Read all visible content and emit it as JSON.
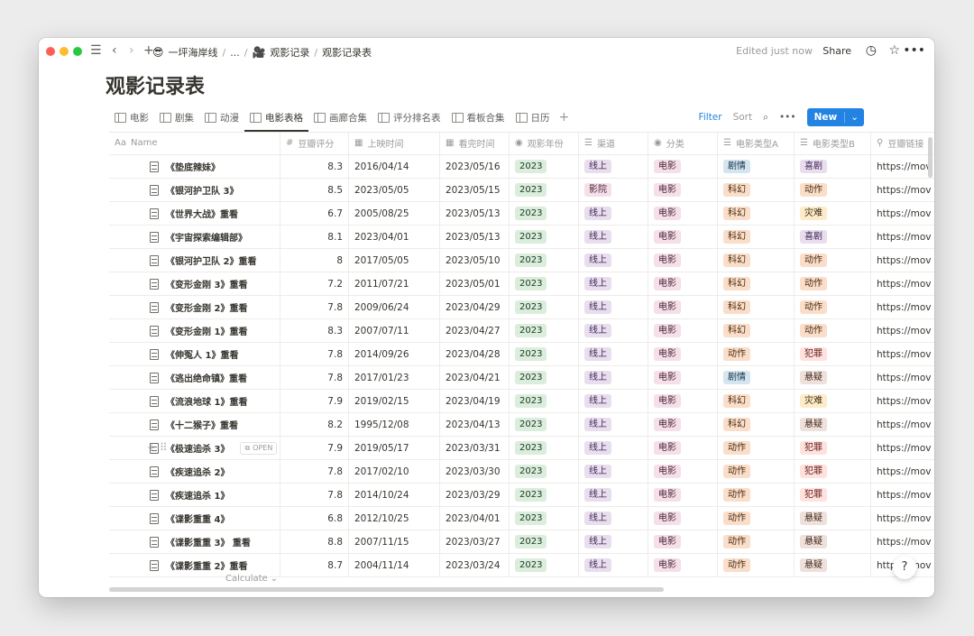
{
  "titlebar": {
    "breadcrumb": [
      {
        "emoji": "😎",
        "label": "一坪海岸线"
      },
      {
        "emoji": "",
        "label": "..."
      },
      {
        "emoji": "🎥",
        "label": "观影记录"
      },
      {
        "emoji": "",
        "label": "观影记录表"
      }
    ],
    "edited": "Edited just now",
    "share": "Share"
  },
  "page_title": "观影记录表",
  "tabs": [
    {
      "label": "电影",
      "active": false
    },
    {
      "label": "剧集",
      "active": false
    },
    {
      "label": "动漫",
      "active": false
    },
    {
      "label": "电影表格",
      "active": true
    },
    {
      "label": "画廊合集",
      "active": false
    },
    {
      "label": "评分排名表",
      "active": false
    },
    {
      "label": "看板合集",
      "active": false
    },
    {
      "label": "日历",
      "active": false
    }
  ],
  "actions": {
    "filter": "Filter",
    "sort": "Sort",
    "new": "New"
  },
  "columns": {
    "name": "Name",
    "score": "豆瓣评分",
    "release": "上映时间",
    "watched": "看完时间",
    "year": "观影年份",
    "channel": "渠道",
    "category": "分类",
    "type_a": "电影类型A",
    "type_b": "电影类型B",
    "link": "豆瓣链接"
  },
  "rows": [
    {
      "name": "《垫底辣妹》",
      "score": "8.3",
      "release": "2016/04/14",
      "watched": "2023/05/16",
      "year": "2023",
      "channel": "线上",
      "category": "电影",
      "type_a": "剧情",
      "type_b": "喜剧",
      "link": "https://mov"
    },
    {
      "name": "《银河护卫队 3》",
      "score": "8.5",
      "release": "2023/05/05",
      "watched": "2023/05/15",
      "year": "2023",
      "channel": "影院",
      "category": "电影",
      "type_a": "科幻",
      "type_b": "动作",
      "link": "https://mov"
    },
    {
      "name": "《世界大战》重看",
      "score": "6.7",
      "release": "2005/08/25",
      "watched": "2023/05/13",
      "year": "2023",
      "channel": "线上",
      "category": "电影",
      "type_a": "科幻",
      "type_b": "灾难",
      "link": "https://mov"
    },
    {
      "name": "《宇宙探索编辑部》",
      "score": "8.1",
      "release": "2023/04/01",
      "watched": "2023/05/13",
      "year": "2023",
      "channel": "线上",
      "category": "电影",
      "type_a": "科幻",
      "type_b": "喜剧",
      "link": "https://mov"
    },
    {
      "name": "《银河护卫队 2》重看",
      "score": "8",
      "release": "2017/05/05",
      "watched": "2023/05/10",
      "year": "2023",
      "channel": "线上",
      "category": "电影",
      "type_a": "科幻",
      "type_b": "动作",
      "link": "https://mov"
    },
    {
      "name": "《变形金刚 3》重看",
      "score": "7.2",
      "release": "2011/07/21",
      "watched": "2023/05/01",
      "year": "2023",
      "channel": "线上",
      "category": "电影",
      "type_a": "科幻",
      "type_b": "动作",
      "link": "https://mov"
    },
    {
      "name": "《变形金刚 2》重看",
      "score": "7.8",
      "release": "2009/06/24",
      "watched": "2023/04/29",
      "year": "2023",
      "channel": "线上",
      "category": "电影",
      "type_a": "科幻",
      "type_b": "动作",
      "link": "https://mov"
    },
    {
      "name": "《变形金刚 1》重看",
      "score": "8.3",
      "release": "2007/07/11",
      "watched": "2023/04/27",
      "year": "2023",
      "channel": "线上",
      "category": "电影",
      "type_a": "科幻",
      "type_b": "动作",
      "link": "https://mov"
    },
    {
      "name": "《伸冤人 1》重看",
      "score": "7.8",
      "release": "2014/09/26",
      "watched": "2023/04/28",
      "year": "2023",
      "channel": "线上",
      "category": "电影",
      "type_a": "动作",
      "type_b": "犯罪",
      "link": "https://mov"
    },
    {
      "name": "《逃出绝命镇》重看",
      "score": "7.8",
      "release": "2017/01/23",
      "watched": "2023/04/21",
      "year": "2023",
      "channel": "线上",
      "category": "电影",
      "type_a": "剧情",
      "type_b": "悬疑",
      "link": "https://mov"
    },
    {
      "name": "《流浪地球 1》重看",
      "score": "7.9",
      "release": "2019/02/15",
      "watched": "2023/04/19",
      "year": "2023",
      "channel": "线上",
      "category": "电影",
      "type_a": "科幻",
      "type_b": "灾难",
      "link": "https://mov"
    },
    {
      "name": "《十二猴子》重看",
      "score": "8.2",
      "release": "1995/12/08",
      "watched": "2023/04/13",
      "year": "2023",
      "channel": "线上",
      "category": "电影",
      "type_a": "科幻",
      "type_b": "悬疑",
      "link": "https://mov"
    },
    {
      "name": "《极速追杀 3》",
      "score": "7.9",
      "release": "2019/05/17",
      "watched": "2023/03/31",
      "year": "2023",
      "channel": "线上",
      "category": "电影",
      "type_a": "动作",
      "type_b": "犯罪",
      "link": "https://mov",
      "hover": true
    },
    {
      "name": "《疾速追杀 2》",
      "score": "7.8",
      "release": "2017/02/10",
      "watched": "2023/03/30",
      "year": "2023",
      "channel": "线上",
      "category": "电影",
      "type_a": "动作",
      "type_b": "犯罪",
      "link": "https://mov"
    },
    {
      "name": "《疾速追杀 1》",
      "score": "7.8",
      "release": "2014/10/24",
      "watched": "2023/03/29",
      "year": "2023",
      "channel": "线上",
      "category": "电影",
      "type_a": "动作",
      "type_b": "犯罪",
      "link": "https://mov"
    },
    {
      "name": "《谍影重重 4》",
      "score": "6.8",
      "release": "2012/10/25",
      "watched": "2023/04/01",
      "year": "2023",
      "channel": "线上",
      "category": "电影",
      "type_a": "动作",
      "type_b": "悬疑",
      "link": "https://mov"
    },
    {
      "name": "《谍影重重 3》 重看",
      "score": "8.8",
      "release": "2007/11/15",
      "watched": "2023/03/27",
      "year": "2023",
      "channel": "线上",
      "category": "电影",
      "type_a": "动作",
      "type_b": "悬疑",
      "link": "https://mov"
    },
    {
      "name": "《谍影重重 2》重看",
      "score": "8.7",
      "release": "2004/11/14",
      "watched": "2023/03/24",
      "year": "2023",
      "channel": "线上",
      "category": "电影",
      "type_a": "动作",
      "type_b": "悬疑",
      "link": "https://mov"
    }
  ],
  "open_label": "OPEN",
  "calculate_label": "Calculate",
  "help_label": "?",
  "tag_colors": {
    "线上": {
      "bg": "#e8deee",
      "fg": "#412454"
    },
    "影院": {
      "bg": "#f5e0e9",
      "fg": "#4c2337"
    },
    "电影": {
      "bg": "#f5e0e9",
      "fg": "#4c2337"
    },
    "剧情": {
      "bg": "#d3e5ef",
      "fg": "#183347"
    },
    "科幻": {
      "bg": "#fadec9",
      "fg": "#49290e"
    },
    "动作": {
      "bg": "#fadec9",
      "fg": "#49290e"
    },
    "喜剧": {
      "bg": "#e8deee",
      "fg": "#412454"
    },
    "灾难": {
      "bg": "#fdecc8",
      "fg": "#402c1b"
    },
    "悬疑": {
      "bg": "#eee0da",
      "fg": "#442a1e"
    },
    "犯罪": {
      "bg": "#ffe2dd",
      "fg": "#5d1715"
    }
  }
}
